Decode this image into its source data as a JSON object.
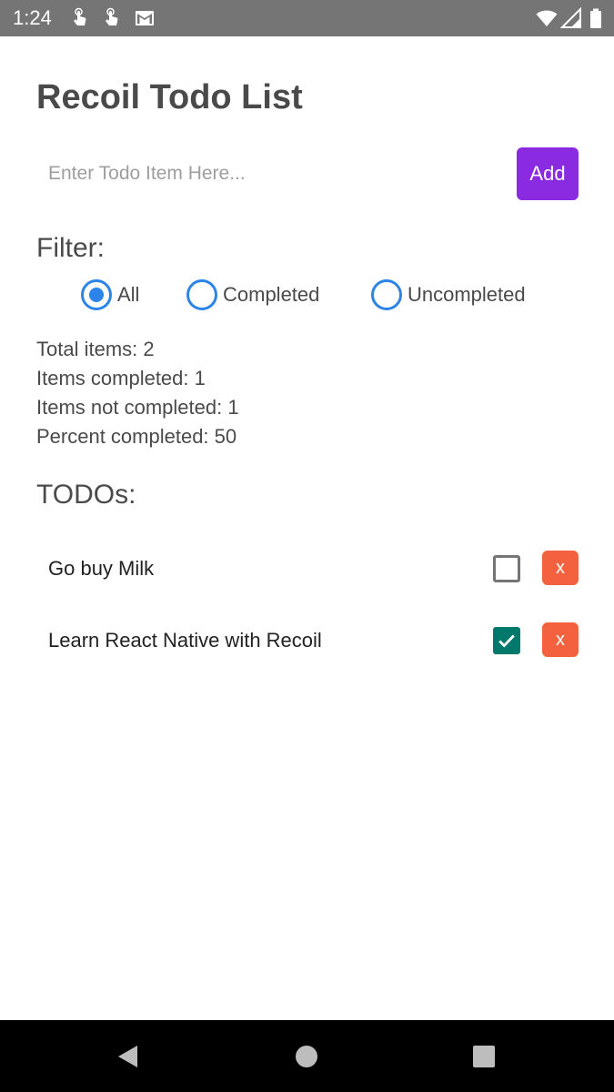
{
  "status_bar": {
    "time": "1:24",
    "icons": [
      "touch-icon",
      "touch-icon",
      "gmail-icon",
      "wifi-icon",
      "signal-icon",
      "battery-icon"
    ]
  },
  "app": {
    "title": "Recoil Todo List",
    "input": {
      "placeholder": "Enter Todo Item Here...",
      "value": ""
    },
    "add_label": "Add",
    "accent_color": "#8a2be2"
  },
  "filter": {
    "heading": "Filter:",
    "options": [
      {
        "label": "All",
        "selected": true
      },
      {
        "label": "Completed",
        "selected": false
      },
      {
        "label": "Uncompleted",
        "selected": false
      }
    ]
  },
  "stats": {
    "total": "Total items: 2",
    "completed": "Items completed: 1",
    "not_completed": "Items not completed: 1",
    "percent": "Percent completed: 50"
  },
  "todos": {
    "heading": "TODOs:",
    "items": [
      {
        "text": "Go buy Milk",
        "completed": false,
        "delete_label": "x"
      },
      {
        "text": "Learn React Native with Recoil",
        "completed": true,
        "delete_label": "x"
      }
    ]
  },
  "colors": {
    "radio": "#2c84e8",
    "delete": "#f4613f",
    "checked": "#00796b"
  },
  "nav_bar": {
    "buttons": [
      "back-icon",
      "home-icon",
      "recents-icon"
    ]
  }
}
